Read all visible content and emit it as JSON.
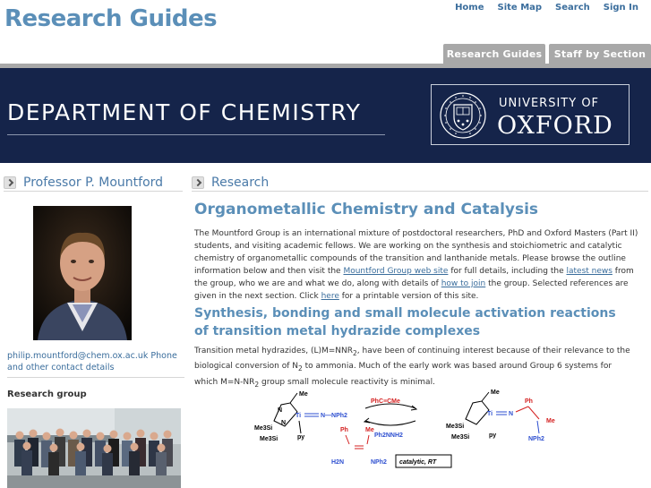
{
  "site": {
    "title": "Research Guides",
    "links": [
      "Home",
      "Site Map",
      "Search",
      "Sign In"
    ]
  },
  "tabs": [
    "Research Guides",
    "Staff by Section"
  ],
  "banner": {
    "department": "DEPARTMENT OF CHEMISTRY",
    "university_line": "UNIVERSITY OF",
    "oxford": "OXFORD"
  },
  "sidebar": {
    "heading": "Professor P. Mountford",
    "email": "philip.mountford@chem.ox.ac.uk",
    "contact_link": "Phone and other contact details",
    "group_heading": "Research group"
  },
  "main": {
    "section_heading": "Research",
    "title": "Organometallic Chemistry and Catalysis",
    "intro": {
      "t1": "The Mountford Group is an international mixture of postdoctoral researchers, PhD and Oxford Masters (Part II) students, and visiting academic fellows. We are working on the synthesis and stoichiometric and catalytic chemistry of organometallic compounds of the transition and lanthanide metals.  Please browse the outline information below and then visit the ",
      "link1": "Mountford Group web site",
      "t2": " for full details, including the ",
      "link2": "latest news",
      "t3": " from the group, who we are and what we do, along with details of ",
      "link3": "how to join",
      "t4": " the group. Selected references are given in the next section. Click ",
      "link4": "here",
      "t5": " for a printable version of this site."
    },
    "subtitle": "Synthesis, bonding and small molecule activation reactions of transition metal hydrazide complexes",
    "para2": {
      "a": "Transition metal hydrazides, (L)M=NNR",
      "sub1": "2",
      "b": ", have been of continuing interest because of their relevance to the biological conversion of N",
      "sub2": "2",
      "c": " to ammonia. Much of the early work was based around Group 6 systems for which M=N-NR",
      "sub3": "2",
      "d": " group small molecule reactivity is minimal."
    },
    "scheme": {
      "me1": "Me",
      "me3si1": "Me3Si",
      "me3si2": "Me3Si",
      "n1": "N",
      "n2": "N",
      "ti1": "Ti",
      "nnph2": "N—NPh2",
      "py1": "py",
      "alkyne": "PhC≡CMe",
      "ph2nnh2": "Ph2NNH2",
      "ph": "Ph",
      "me": "Me",
      "h2n": "H2N",
      "nph2": "NPh2",
      "catalytic": "catalytic, RT",
      "me2": "Me",
      "me3si3": "Me3Si",
      "me3si4": "Me3Si",
      "ti2": "Ti",
      "n3": "N",
      "py2": "py",
      "ph2": "Ph",
      "me4": "Me",
      "nph2b": "NPh2"
    }
  },
  "colors": {
    "accent": "#5b8fb8",
    "link": "#3a6d9c",
    "banner": "#15244a",
    "tab": "#a8a8a8"
  }
}
